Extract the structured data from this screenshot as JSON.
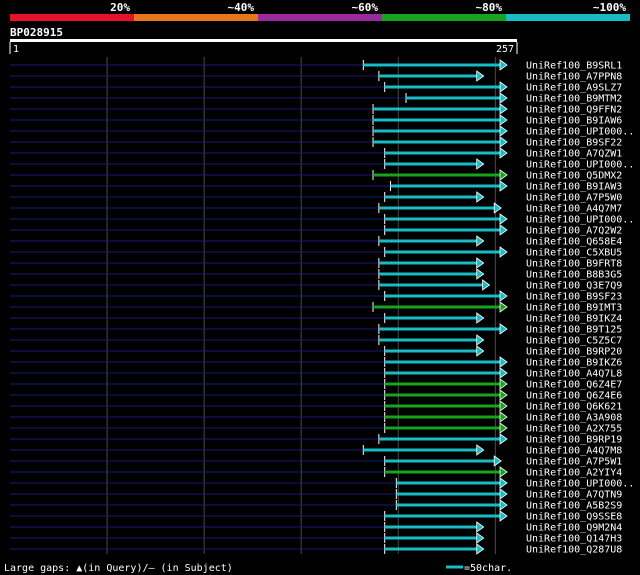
{
  "chart_data": {
    "type": "alignment-map",
    "query": {
      "name": "BP028915",
      "start": 1,
      "end": 257,
      "start_label": "1",
      "end_label": "257"
    },
    "identity_legend": [
      {
        "label": "20%",
        "color": "#e8102a"
      },
      {
        "label": "~40%",
        "color": "#e8761a"
      },
      {
        "label": "~60%",
        "color": "#9a2aa0"
      },
      {
        "label": "~80%",
        "color": "#16a320"
      },
      {
        "label": "~100%",
        "color": "#17bcc4"
      }
    ],
    "colors": {
      "cyan": "#17bcc4",
      "green": "#16a320",
      "leader": "#1a1a78",
      "grid": "#4a4a4a"
    },
    "hits": [
      {
        "name": "UniRef100_B9SRL1",
        "start": 183,
        "end": 257,
        "color": "cyan"
      },
      {
        "name": "UniRef100_A7PPN8",
        "start": 191,
        "end": 245,
        "color": "cyan"
      },
      {
        "name": "UniRef100_A9SLZ7",
        "start": 194,
        "end": 257,
        "color": "cyan"
      },
      {
        "name": "UniRef100_B9MTM2",
        "start": 205,
        "end": 257,
        "color": "cyan"
      },
      {
        "name": "UniRef100_Q9FFN2",
        "start": 188,
        "end": 257,
        "color": "cyan"
      },
      {
        "name": "UniRef100_B9IAW6",
        "start": 188,
        "end": 257,
        "color": "cyan"
      },
      {
        "name": "UniRef100_UPI000..",
        "start": 188,
        "end": 257,
        "color": "cyan"
      },
      {
        "name": "UniRef100_B9SF22",
        "start": 188,
        "end": 257,
        "color": "cyan"
      },
      {
        "name": "UniRef100_A7QZW1",
        "start": 194,
        "end": 257,
        "color": "cyan"
      },
      {
        "name": "UniRef100_UPI000..",
        "start": 194,
        "end": 245,
        "color": "cyan"
      },
      {
        "name": "UniRef100_Q5DMX2",
        "start": 188,
        "end": 257,
        "color": "green"
      },
      {
        "name": "UniRef100_B9IAW3",
        "start": 197,
        "end": 257,
        "color": "cyan"
      },
      {
        "name": "UniRef100_A7P5W0",
        "start": 194,
        "end": 245,
        "color": "cyan"
      },
      {
        "name": "UniRef100_A4Q7M7",
        "start": 191,
        "end": 254,
        "color": "cyan"
      },
      {
        "name": "UniRef100_UPI000..",
        "start": 194,
        "end": 257,
        "color": "cyan"
      },
      {
        "name": "UniRef100_A7Q2W2",
        "start": 194,
        "end": 257,
        "color": "cyan"
      },
      {
        "name": "UniRef100_Q658E4",
        "start": 191,
        "end": 245,
        "color": "cyan"
      },
      {
        "name": "UniRef100_C5XBU5",
        "start": 194,
        "end": 257,
        "color": "cyan"
      },
      {
        "name": "UniRef100_B9FRT8",
        "start": 191,
        "end": 245,
        "color": "cyan"
      },
      {
        "name": "UniRef100_B8B3G5",
        "start": 191,
        "end": 245,
        "color": "cyan"
      },
      {
        "name": "UniRef100_Q3E7Q9",
        "start": 191,
        "end": 248,
        "color": "cyan"
      },
      {
        "name": "UniRef100_B9SF23",
        "start": 194,
        "end": 257,
        "color": "cyan"
      },
      {
        "name": "UniRef100_B9IMT3",
        "start": 188,
        "end": 257,
        "color": "green"
      },
      {
        "name": "UniRef100_B9IKZ4",
        "start": 194,
        "end": 245,
        "color": "cyan"
      },
      {
        "name": "UniRef100_B9T125",
        "start": 191,
        "end": 257,
        "color": "cyan"
      },
      {
        "name": "UniRef100_C5Z5C7",
        "start": 191,
        "end": 245,
        "color": "cyan"
      },
      {
        "name": "UniRef100_B9RP20",
        "start": 194,
        "end": 245,
        "color": "cyan"
      },
      {
        "name": "UniRef100_B9IKZ6",
        "start": 194,
        "end": 257,
        "color": "cyan"
      },
      {
        "name": "UniRef100_A4Q7L8",
        "start": 194,
        "end": 257,
        "color": "cyan"
      },
      {
        "name": "UniRef100_Q6Z4E7",
        "start": 194,
        "end": 257,
        "color": "green"
      },
      {
        "name": "UniRef100_Q6Z4E6",
        "start": 194,
        "end": 257,
        "color": "green"
      },
      {
        "name": "UniRef100_Q6K621",
        "start": 194,
        "end": 257,
        "color": "green"
      },
      {
        "name": "UniRef100_A3A908",
        "start": 194,
        "end": 257,
        "color": "green"
      },
      {
        "name": "UniRef100_A2X755",
        "start": 194,
        "end": 257,
        "color": "green"
      },
      {
        "name": "UniRef100_B9RP19",
        "start": 191,
        "end": 257,
        "color": "cyan"
      },
      {
        "name": "UniRef100_A4Q7M8",
        "start": 183,
        "end": 245,
        "color": "cyan"
      },
      {
        "name": "UniRef100_A7P5W1",
        "start": 194,
        "end": 254,
        "color": "cyan"
      },
      {
        "name": "UniRef100_A2YIY4",
        "start": 194,
        "end": 257,
        "color": "green"
      },
      {
        "name": "UniRef100_UPI000..",
        "start": 200,
        "end": 257,
        "color": "cyan"
      },
      {
        "name": "UniRef100_A7QTN9",
        "start": 200,
        "end": 257,
        "color": "cyan"
      },
      {
        "name": "UniRef100_A5B2S9",
        "start": 200,
        "end": 257,
        "color": "cyan"
      },
      {
        "name": "UniRef100_Q9SSE8",
        "start": 194,
        "end": 257,
        "color": "cyan"
      },
      {
        "name": "UniRef100_Q9M2N4",
        "start": 194,
        "end": 245,
        "color": "cyan"
      },
      {
        "name": "UniRef100_Q147H3",
        "start": 194,
        "end": 245,
        "color": "cyan"
      },
      {
        "name": "UniRef100_Q287U8",
        "start": 194,
        "end": 245,
        "color": "cyan"
      }
    ]
  },
  "footer": {
    "gaps_label": "Large gaps: ▲(in Query)/– (in Subject)",
    "scale_label": "=50char."
  }
}
